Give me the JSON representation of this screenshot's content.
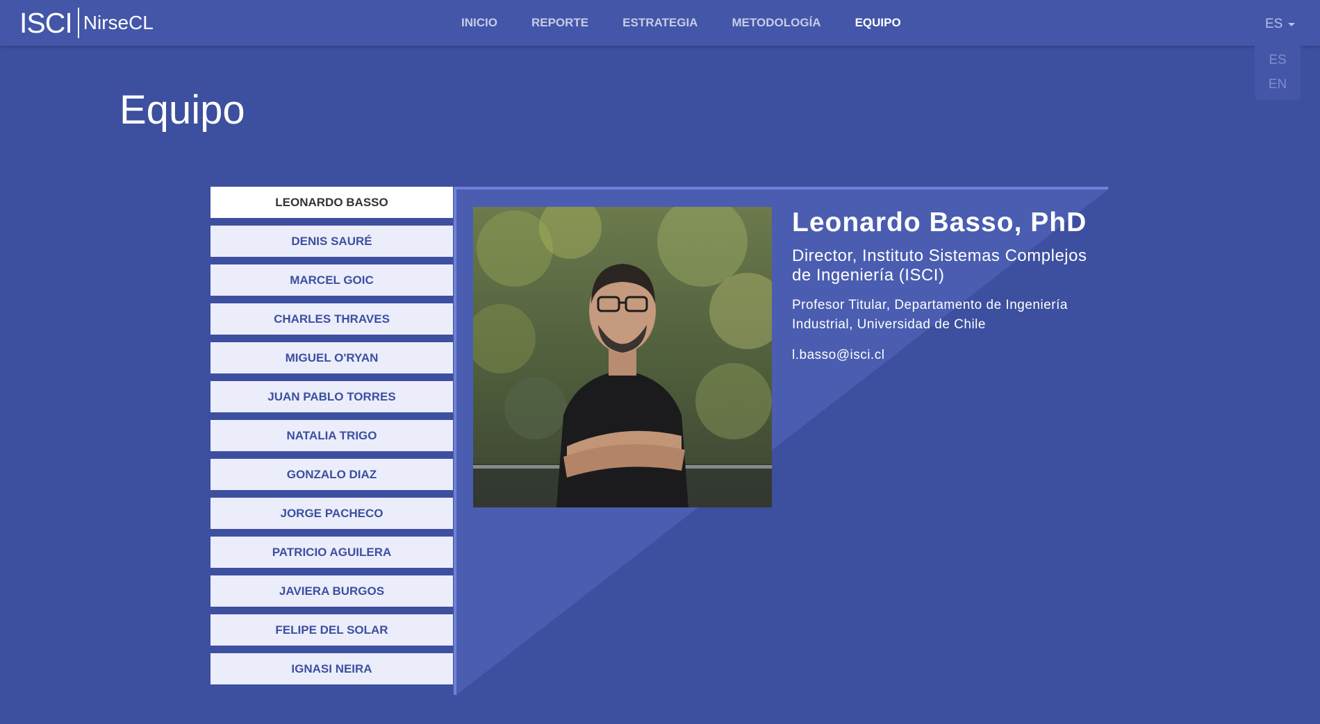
{
  "header": {
    "logo_isci": "ISCI",
    "logo_nirse": "NirseCL",
    "nav": [
      {
        "label": "INICIO",
        "active": false
      },
      {
        "label": "REPORTE",
        "active": false
      },
      {
        "label": "ESTRATEGIA",
        "active": false
      },
      {
        "label": "METODOLOGÍA",
        "active": false
      },
      {
        "label": "EQUIPO",
        "active": true
      }
    ],
    "language": {
      "current": "ES",
      "options": [
        "ES",
        "EN"
      ]
    }
  },
  "page": {
    "title": "Equipo"
  },
  "team": {
    "members": [
      {
        "label": "LEONARDO BASSO",
        "active": true
      },
      {
        "label": "DENIS SAURÉ",
        "active": false
      },
      {
        "label": "MARCEL GOIC",
        "active": false
      },
      {
        "label": "CHARLES THRAVES",
        "active": false
      },
      {
        "label": "MIGUEL O'RYAN",
        "active": false
      },
      {
        "label": "JUAN PABLO TORRES",
        "active": false
      },
      {
        "label": "NATALIA TRIGO",
        "active": false
      },
      {
        "label": "GONZALO DIAZ",
        "active": false
      },
      {
        "label": "JORGE PACHECO",
        "active": false
      },
      {
        "label": "PATRICIO AGUILERA",
        "active": false
      },
      {
        "label": "JAVIERA BURGOS",
        "active": false
      },
      {
        "label": "FELIPE DEL SOLAR",
        "active": false
      },
      {
        "label": "IGNASI NEIRA",
        "active": false
      }
    ]
  },
  "profile": {
    "name": "Leonardo Basso, PhD",
    "role": "Director, Instituto Sistemas Complejos de Ingeniería (ISCI)",
    "affiliation": "Profesor Titular, Departamento de Ingeniería Industrial, Universidad de Chile",
    "email": "l.basso@isci.cl"
  },
  "colors": {
    "background": "#3d4f9f",
    "navbar": "#4356a8",
    "accent_line": "#6f81d6",
    "list_item_bg": "#ebedfb",
    "list_item_active_bg": "#ffffff",
    "text_light": "#ffffff"
  }
}
